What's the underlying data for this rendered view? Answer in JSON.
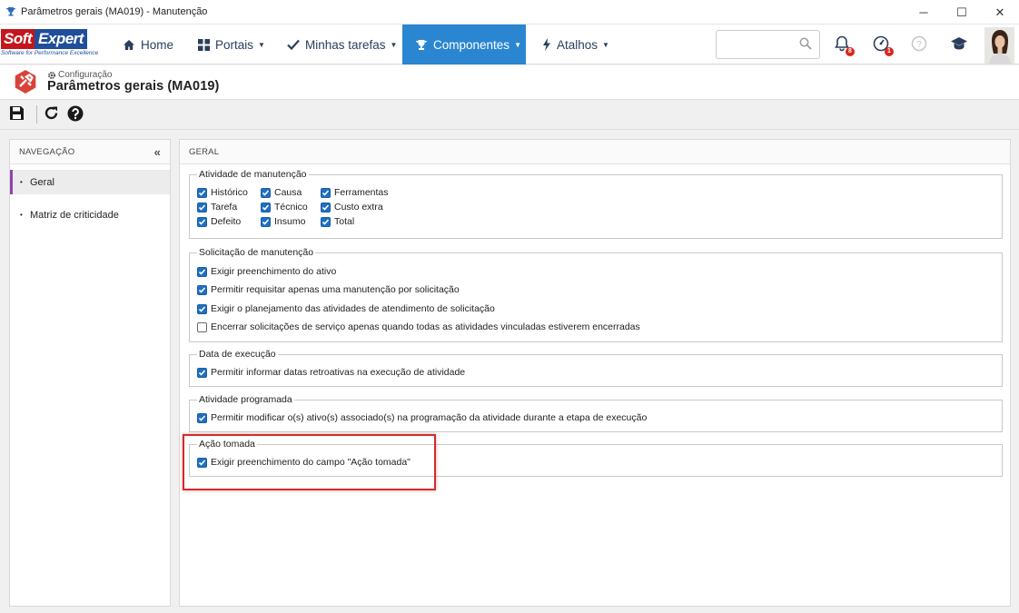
{
  "window": {
    "title": "Parâmetros gerais (MA019) - Manutenção",
    "controls": {
      "minimize": "─",
      "maximize": "☐",
      "close": "✕"
    }
  },
  "logo": {
    "part1": "Soft",
    "part2": "Expert",
    "tagline": "Software for Performance Excellence"
  },
  "nav": {
    "items": [
      {
        "label": "Home",
        "icon": "home-icon",
        "dropdown": false
      },
      {
        "label": "Portais",
        "icon": "grid-icon",
        "dropdown": true
      },
      {
        "label": "Minhas tarefas",
        "icon": "check-icon",
        "dropdown": true
      },
      {
        "label": "Componentes",
        "icon": "trophy-icon",
        "dropdown": true,
        "active": true
      },
      {
        "label": "Atalhos",
        "icon": "bolt-icon",
        "dropdown": true
      }
    ],
    "search_placeholder": "",
    "notifications_count": "8",
    "tasks_count": "1"
  },
  "page": {
    "breadcrumb": "Configuração",
    "title": "Parâmetros gerais (MA019)"
  },
  "toolbar": {
    "buttons": [
      "save-icon",
      "refresh-icon",
      "help-icon"
    ]
  },
  "navigation": {
    "header": "NAVEGAÇÃO",
    "items": [
      {
        "label": "Geral",
        "selected": true
      },
      {
        "label": "Matriz de criticidade",
        "selected": false
      }
    ]
  },
  "main": {
    "header": "GERAL",
    "sections": [
      {
        "legend": "Atividade de manutenção",
        "columns": [
          [
            {
              "label": "Histórico",
              "checked": true
            },
            {
              "label": "Tarefa",
              "checked": true
            },
            {
              "label": "Defeito",
              "checked": true
            }
          ],
          [
            {
              "label": "Causa",
              "checked": true
            },
            {
              "label": "Técnico",
              "checked": true
            },
            {
              "label": "Insumo",
              "checked": true
            }
          ],
          [
            {
              "label": "Ferramentas",
              "checked": true
            },
            {
              "label": "Custo extra",
              "checked": true
            },
            {
              "label": "Total",
              "checked": true
            }
          ]
        ]
      },
      {
        "legend": "Solicitação de manutenção",
        "items": [
          {
            "label": "Exigir preenchimento do ativo",
            "checked": true
          },
          {
            "label": "Permitir requisitar apenas uma manutenção por solicitação",
            "checked": true
          },
          {
            "label": "Exigir o planejamento das atividades de atendimento de solicitação",
            "checked": true
          },
          {
            "label": "Encerrar solicitações de serviço apenas quando todas as atividades vinculadas estiverem encerradas",
            "checked": false
          }
        ]
      },
      {
        "legend": "Data de execução",
        "items": [
          {
            "label": "Permitir informar datas retroativas na execução de atividade",
            "checked": true
          }
        ]
      },
      {
        "legend": "Atividade programada",
        "items": [
          {
            "label": "Permitir modificar o(s) ativo(s) associado(s) na programação da atividade durante a etapa de execução",
            "checked": true
          }
        ]
      },
      {
        "legend": "Ação tomada",
        "items": [
          {
            "label": "Exigir preenchimento do campo \"Ação tomada\"",
            "checked": true
          }
        ]
      }
    ]
  },
  "colors": {
    "accent": "#2b86d1",
    "checkbox": "#1f6fc2",
    "highlight": "#d42a2a",
    "nav_selected": "#8e44ad"
  }
}
